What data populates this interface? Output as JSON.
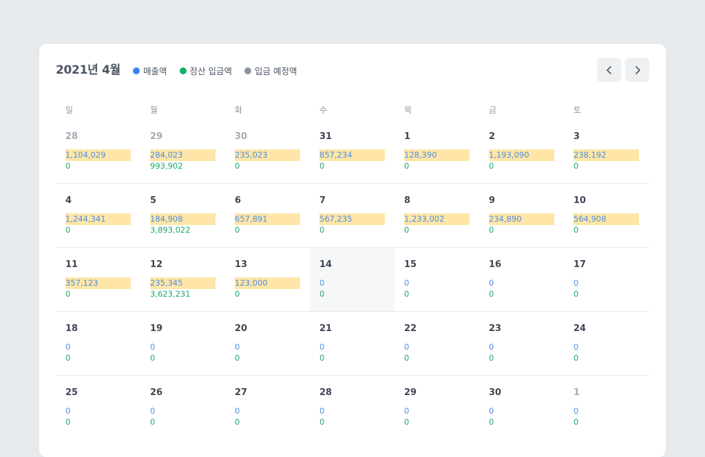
{
  "header": {
    "title": "2021년 4월",
    "prev_icon": "chevron-left-icon",
    "next_icon": "chevron-right-icon"
  },
  "legend": [
    {
      "label": "매출액",
      "color": "#3b82f6"
    },
    {
      "label": "정산 입금액",
      "color": "#10b069"
    },
    {
      "label": "입금 예정액",
      "color": "#8a949f"
    }
  ],
  "weekdays": [
    "일",
    "월",
    "화",
    "수",
    "목",
    "금",
    "토"
  ],
  "colors": {
    "sales": "#4d8fe0",
    "deposit": "#1ea86a",
    "highlight": "#ffe6a8",
    "today_bg": "#f6f7f9"
  },
  "weeks": [
    [
      {
        "day": "28",
        "sales": "1,104,029",
        "deposit": "0",
        "highlight": true,
        "muted": true
      },
      {
        "day": "29",
        "sales": "284,023",
        "deposit": "993,902",
        "highlight": true,
        "muted": true
      },
      {
        "day": "30",
        "sales": "235,023",
        "deposit": "0",
        "highlight": true,
        "muted": true
      },
      {
        "day": "31",
        "sales": "857,234",
        "deposit": "0",
        "highlight": true
      },
      {
        "day": "1",
        "sales": "128,390",
        "deposit": "0",
        "highlight": true
      },
      {
        "day": "2",
        "sales": "1,193,090",
        "deposit": "0",
        "highlight": true
      },
      {
        "day": "3",
        "sales": "238,192",
        "deposit": "0",
        "highlight": true
      }
    ],
    [
      {
        "day": "4",
        "sales": "1,244,341",
        "deposit": "0",
        "highlight": true
      },
      {
        "day": "5",
        "sales": "184,908",
        "deposit": "3,893,022",
        "highlight": true
      },
      {
        "day": "6",
        "sales": "657,891",
        "deposit": "0",
        "highlight": true
      },
      {
        "day": "7",
        "sales": "567,235",
        "deposit": "0",
        "highlight": true
      },
      {
        "day": "8",
        "sales": "1,233,002",
        "deposit": "0",
        "highlight": true
      },
      {
        "day": "9",
        "sales": "234,890",
        "deposit": "0",
        "highlight": true
      },
      {
        "day": "10",
        "sales": "564,908",
        "deposit": "0",
        "highlight": true
      }
    ],
    [
      {
        "day": "11",
        "sales": "357,123",
        "deposit": "0",
        "highlight": true
      },
      {
        "day": "12",
        "sales": "235,345",
        "deposit": "3,623,231",
        "highlight": true
      },
      {
        "day": "13",
        "sales": "123,000",
        "deposit": "0",
        "highlight": true
      },
      {
        "day": "14",
        "sales": "0",
        "deposit": "0",
        "today": true
      },
      {
        "day": "15",
        "sales": "0",
        "deposit": "0"
      },
      {
        "day": "16",
        "sales": "0",
        "deposit": "0"
      },
      {
        "day": "17",
        "sales": "0",
        "deposit": "0"
      }
    ],
    [
      {
        "day": "18",
        "sales": "0",
        "deposit": "0"
      },
      {
        "day": "19",
        "sales": "0",
        "deposit": "0"
      },
      {
        "day": "20",
        "sales": "0",
        "deposit": "0"
      },
      {
        "day": "21",
        "sales": "0",
        "deposit": "0"
      },
      {
        "day": "22",
        "sales": "0",
        "deposit": "0"
      },
      {
        "day": "23",
        "sales": "0",
        "deposit": "0"
      },
      {
        "day": "24",
        "sales": "0",
        "deposit": "0"
      }
    ],
    [
      {
        "day": "25",
        "sales": "0",
        "deposit": "0"
      },
      {
        "day": "26",
        "sales": "0",
        "deposit": "0"
      },
      {
        "day": "27",
        "sales": "0",
        "deposit": "0"
      },
      {
        "day": "28",
        "sales": "0",
        "deposit": "0"
      },
      {
        "day": "29",
        "sales": "0",
        "deposit": "0"
      },
      {
        "day": "30",
        "sales": "0",
        "deposit": "0"
      },
      {
        "day": "1",
        "sales": "0",
        "deposit": "0",
        "muted": true
      }
    ]
  ]
}
